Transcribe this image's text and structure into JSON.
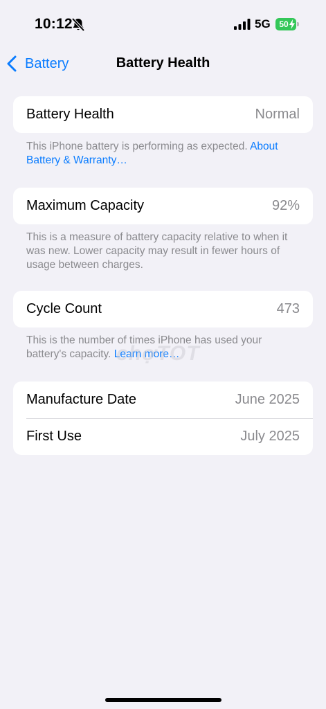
{
  "status": {
    "time": "10:12",
    "network": "5G",
    "battery_level": "50"
  },
  "nav": {
    "back_label": "Battery",
    "title": "Battery Health"
  },
  "health": {
    "label": "Battery Health",
    "value": "Normal",
    "footer_text": "This iPhone battery is performing as expected. ",
    "footer_link": "About Battery & Warranty…"
  },
  "capacity": {
    "label": "Maximum Capacity",
    "value": "92%",
    "footer_text": "This is a measure of battery capacity relative to when it was new. Lower capacity may result in fewer hours of usage between charges."
  },
  "cycles": {
    "label": "Cycle Count",
    "value": "473",
    "footer_text": "This is the number of times iPhone has used your battery's capacity. ",
    "footer_link": "Learn more…"
  },
  "dates": {
    "manufacture_label": "Manufacture Date",
    "manufacture_value": "June 2025",
    "first_use_label": "First Use",
    "first_use_value": "July 2025"
  },
  "watermark": "chợTOT",
  "colors": {
    "accent": "#0a7cff",
    "battery_green": "#34c759",
    "background": "#f2f1f7"
  }
}
